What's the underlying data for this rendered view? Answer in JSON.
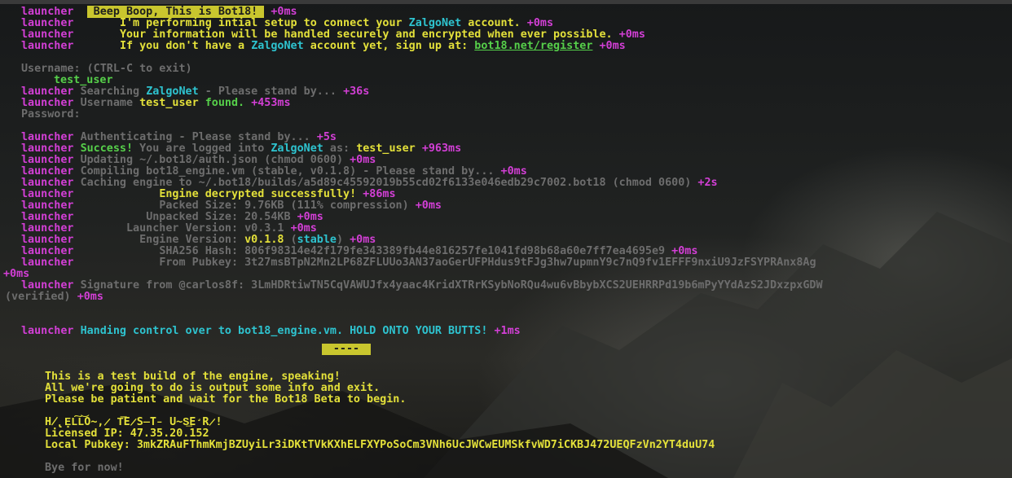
{
  "terminal": {
    "tag": "launcher",
    "lines": {
      "l1_banner": " Beep Boop, This is Bot18! ",
      "l1_time": "+0ms",
      "l2_a": "I'm performing intial setup to connect your ",
      "l2_zn": "ZalgoNet",
      "l2_b": " account.",
      "l2_time": "+0ms",
      "l3_text": "Your information will be handled securely and encrypted when ever possible.",
      "l3_time": "+0ms",
      "l4_a": "If you don't have a ",
      "l4_zn": "ZalgoNet",
      "l4_b": " account yet, sign up at: ",
      "l4_link": "bot18.net/register",
      "l4_time": "+0ms",
      "username_prompt": "Username: (CTRL-C to exit)",
      "username_value": "test_user",
      "search_a": "Searching ",
      "search_zn": "ZalgoNet",
      "search_b": " - Please stand by...",
      "search_time": "+36s",
      "uname_a": "Username ",
      "uname_val": "test_user",
      "uname_found": " found.",
      "uname_time": "+453ms",
      "password_prompt": "Password:",
      "auth_text": "Authenticating - Please stand by...",
      "auth_time": "+5s",
      "success_a": "Success!",
      "success_b": " You are logged into ",
      "success_zn": "ZalgoNet",
      "success_c": " as: ",
      "success_user": "test_user",
      "success_time": "+963ms",
      "updating_text": "Updating ~/.bot18/auth.json (chmod 0600)",
      "updating_time": "+0ms",
      "compiling_text": "Compiling bot18_engine.vm (stable, v0.1.8) - Please stand by...",
      "compiling_time": "+0ms",
      "caching_text": "Caching engine to ~/.bot18/builds/a5d89c45592019b55cd02f6133e046edb29c7002.bot18 (chmod 0600)",
      "caching_time": "+2s",
      "decrypted_text": "Engine decrypted successfully!",
      "decrypted_time": "+86ms",
      "packed_label": "Packed Size:",
      "packed_value": " 9.76KB (111% compression)",
      "packed_time": "+0ms",
      "unpacked_label": "Unpacked Size:",
      "unpacked_value": " 20.54KB",
      "unpacked_time": "+0ms",
      "launcher_ver_label": "Launcher Version:",
      "launcher_ver_value": " v0.3.1",
      "launcher_ver_time": "+0ms",
      "engine_ver_label": "Engine Version:",
      "engine_ver_value": "v0.1.8",
      "engine_ver_stable": "stable",
      "engine_ver_time": "+0ms",
      "sha_label": "SHA256 Hash:",
      "sha_value": " 806f98314e42f179fe343389fb44e816257fe1041fd98b68a60e7ff7ea4695e9",
      "sha_time": "+0ms",
      "pubkey_label": "From Pubkey:",
      "pubkey_value": " 3t27msBTpN2Mn2LP68ZFLUUo3AN37aoGerUFPHdus9tFJg3hw7upmnY9c7nQ9fv1EFFF9nxiU9JzFSYPRAnx8Ag",
      "wrap_time": "+0ms",
      "sig_text": "Signature from @carlos8f: 3LmHDRtiwTN5CqVAWUJfx4yaac4KridXTRrKSybNoRQu4wu6vBbybXCS2UEHRRPd19b6mPyYYdAzS2JDxzpxGDW",
      "verified_text": "(verified)",
      "verified_time": "+0ms",
      "handing_text": "Handing control over to bot18_engine.vm. HOLD ONTO YOUR BUTTS!",
      "handing_time": "+1ms",
      "dashes": "----",
      "test_build": "This is a test build of the engine, speaking!",
      "output_info": "All we're going to do is output some info and exit.",
      "patient": "Please be patient and wait for the Bot18 Beta to begin.",
      "hello": "H̸̢E͓L͠L͝O̴,̷ T͞E̷S̶T̵ U̴S͢E̛R̷!",
      "licensed_ip": "Licensed IP: 47.35.20.152",
      "local_pubkey": "Local Pubkey: 3mkZRAuFThmKmjBZUyiLr3iDKtTVkKXhELFXYPoSoCm3VNh6UcJWCwEUMSkfvWD7iCKBJ472UEQFzVn2YT4duU74",
      "bye": "Bye for now!"
    }
  },
  "colors": {
    "magenta": "#d33fd6",
    "yellow": "#e3e03a",
    "cyan": "#2ec3cf",
    "green": "#56d04a",
    "dim": "#6d6d6d"
  }
}
